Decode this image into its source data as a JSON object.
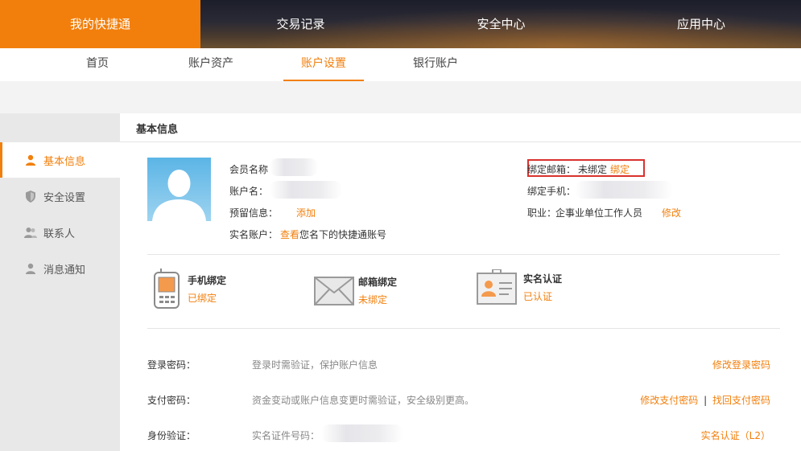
{
  "topnav": {
    "items": [
      "我的快捷通",
      "交易记录",
      "安全中心",
      "应用中心"
    ]
  },
  "subnav": {
    "tabs": [
      "首页",
      "账户资产",
      "账户设置",
      "银行账户"
    ]
  },
  "sidebar": {
    "items": [
      {
        "label": "基本信息",
        "icon": "person-icon"
      },
      {
        "label": "安全设置",
        "icon": "shield-icon"
      },
      {
        "label": "联系人",
        "icon": "contacts-icon"
      },
      {
        "label": "消息通知",
        "icon": "person-icon"
      }
    ]
  },
  "section": {
    "title": "基本信息"
  },
  "profile": {
    "member_name_label": "会员名称",
    "account_name_label": "账户名：",
    "reserved_info_label": "预留信息：",
    "reserved_info_action": "添加",
    "realname_label": "实名账户：",
    "realname_link": "查看",
    "realname_text": "您名下的快捷通账号",
    "email_label": "绑定邮箱：",
    "email_status": "未绑定",
    "email_action": "绑定",
    "phone_label": "绑定手机：",
    "job_label": "职业：",
    "job_value": "企事业单位工作人员",
    "job_action": "修改"
  },
  "bindings": [
    {
      "title": "手机绑定",
      "status": "已绑定",
      "icon": "mobile-phone-icon"
    },
    {
      "title": "邮箱绑定",
      "status": "未绑定",
      "icon": "envelope-icon"
    },
    {
      "title": "实名认证",
      "status": "已认证",
      "icon": "id-card-icon"
    }
  ],
  "password_rows": [
    {
      "label": "登录密码：",
      "desc": "登录时需验证，保护账户信息",
      "actions": [
        "修改登录密码"
      ]
    },
    {
      "label": "支付密码：",
      "desc": "资金变动或账户信息变更时需验证，安全级别更高。",
      "actions": [
        "修改支付密码",
        "找回支付密码"
      ],
      "separator": "|"
    },
    {
      "label": "身份验证：",
      "desc": "实名证件号码：",
      "actions": [
        "实名认证（L2）"
      ]
    }
  ],
  "colors": {
    "accent": "#f27f0c",
    "highlight": "#d9322d"
  }
}
